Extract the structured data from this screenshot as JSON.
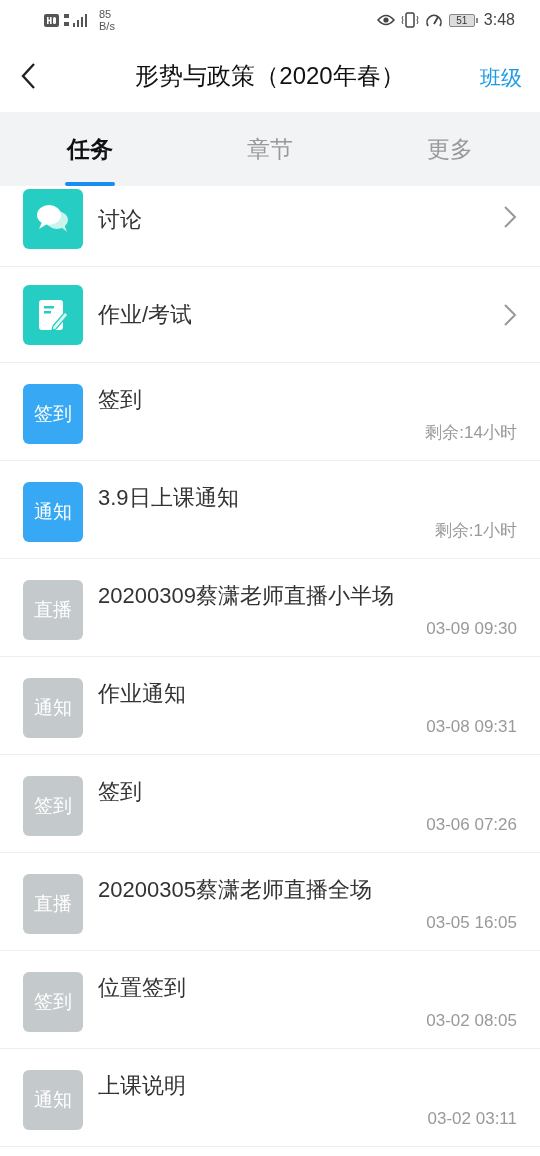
{
  "status_bar": {
    "net_speed_value": "85",
    "net_speed_unit": "B/s",
    "battery": "51",
    "time": "3:48"
  },
  "header": {
    "title": "形势与政策（2020年春）",
    "action": "班级"
  },
  "tabs": [
    {
      "label": "任务",
      "selected": true
    },
    {
      "label": "章节",
      "selected": false
    },
    {
      "label": "更多",
      "selected": false
    }
  ],
  "items": [
    {
      "kind": "entry",
      "title": "讨论"
    },
    {
      "kind": "entry",
      "title": "作业/考试"
    },
    {
      "kind": "task",
      "badge": "签到",
      "active": true,
      "title": "签到",
      "meta": "剩余:14小时"
    },
    {
      "kind": "task",
      "badge": "通知",
      "active": true,
      "title": "3.9日上课通知",
      "meta": "剩余:1小时"
    },
    {
      "kind": "task",
      "badge": "直播",
      "active": false,
      "title": "20200309蔡潇老师直播小半场",
      "meta": "03-09 09:30"
    },
    {
      "kind": "task",
      "badge": "通知",
      "active": false,
      "title": "作业通知",
      "meta": "03-08 09:31"
    },
    {
      "kind": "task",
      "badge": "签到",
      "active": false,
      "title": "签到",
      "meta": "03-06 07:26"
    },
    {
      "kind": "task",
      "badge": "直播",
      "active": false,
      "title": "20200305蔡潇老师直播全场",
      "meta": "03-05 16:05"
    },
    {
      "kind": "task",
      "badge": "签到",
      "active": false,
      "title": "位置签到",
      "meta": "03-02 08:05"
    },
    {
      "kind": "task",
      "badge": "通知",
      "active": false,
      "title": "上课说明",
      "meta": "03-02 03:11"
    }
  ]
}
